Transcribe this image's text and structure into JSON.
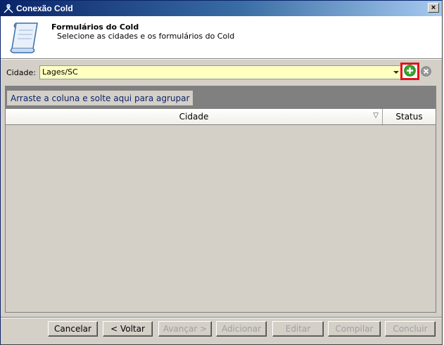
{
  "window": {
    "title": "Conexão Cold",
    "close_label": "×"
  },
  "header": {
    "title": "Formulários do Cold",
    "subtitle": "Selecione as cidades e os formulários do Cold"
  },
  "city": {
    "label": "Cidade:",
    "value": "Lages/SC"
  },
  "grid": {
    "group_hint": "Arraste a coluna e solte aqui para agrupar",
    "columns": [
      "Cidade",
      "Status"
    ],
    "rows": []
  },
  "buttons": {
    "cancel": "Cancelar",
    "back": "< Voltar",
    "next": "Avançar >",
    "add": "Adicionar",
    "edit": "Editar",
    "compile": "Compilar",
    "finish": "Concluir"
  },
  "colors": {
    "combo_bg": "#ffffc0",
    "highlight": "#e0141e",
    "add_icon": "#3aa630",
    "group_area": "#808080"
  }
}
